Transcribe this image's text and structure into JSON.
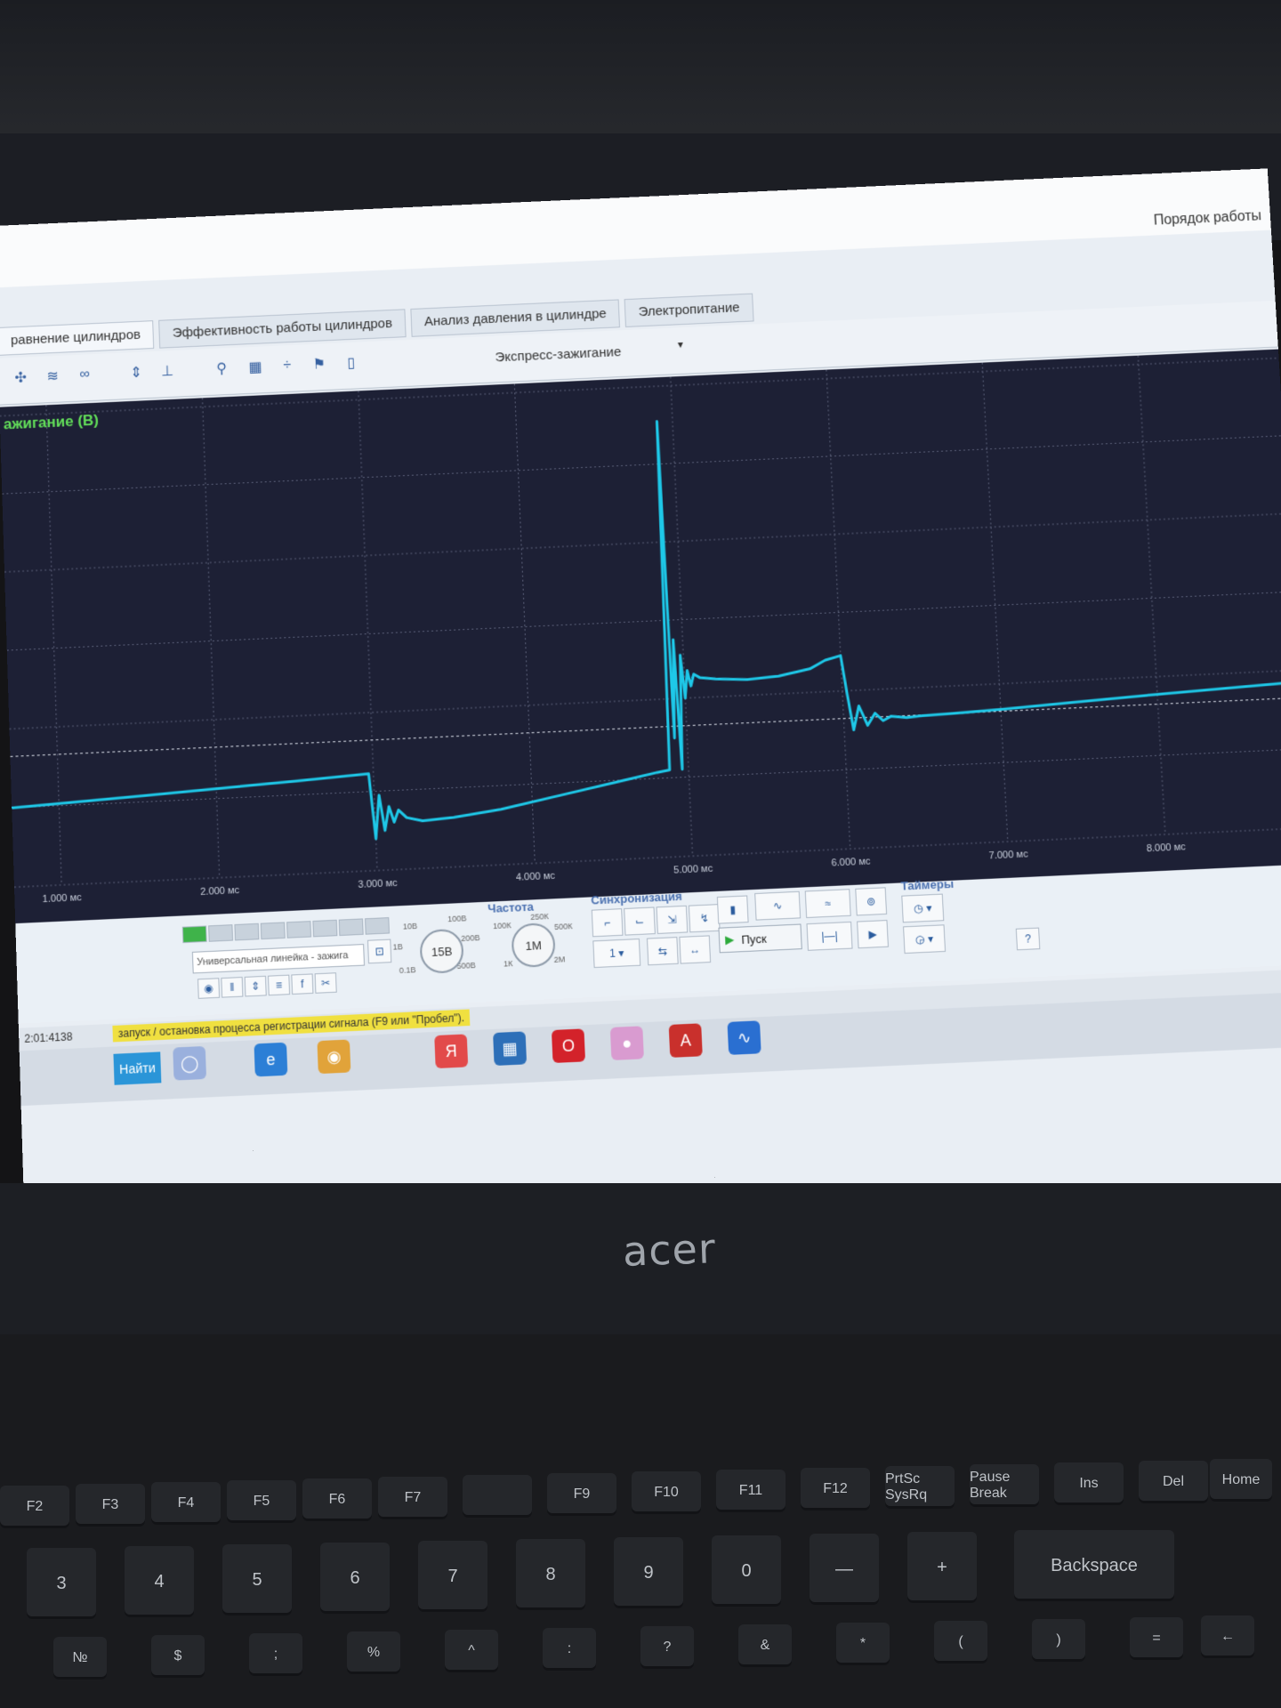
{
  "window": {
    "title": "Порядок работы"
  },
  "tabs": [
    {
      "label": "равнение цилиндров",
      "active": true
    },
    {
      "label": "Эффективность работы цилиндров",
      "active": false
    },
    {
      "label": "Анализ давления в цилиндре",
      "active": false
    },
    {
      "label": "Электропитание",
      "active": false
    }
  ],
  "toolbar": {
    "mode": "Экспресс-зажигание",
    "icons": [
      "cursor-icon",
      "overlay-icon",
      "parade-icon",
      "raster-icon",
      "trigger-level-icon",
      "zero-icon",
      "filter-icon",
      "table-icon",
      "split-icon",
      "marker-icon",
      "document-icon"
    ]
  },
  "plot": {
    "channel_label": "ажигание (В)",
    "x_ticks": [
      "1.000 мс",
      "2.000 мс",
      "3.000 мс",
      "4.000 мс",
      "5.000 мс",
      "6.000 мс",
      "7.000 мс",
      "8.000 мс"
    ],
    "trace_color": "#1ec8e8",
    "grid_color": "#5a5f78",
    "background": "#1d2035"
  },
  "controls": {
    "preset": "Универсальная линейка - зажига",
    "voltage_knob": "15В",
    "voltage_marks": [
      "10В",
      "100В",
      "1В",
      "200В",
      "0.1В",
      "500В"
    ],
    "frequency_title": "Частота",
    "frequency_knob": "1М",
    "frequency_marks": [
      "250К",
      "100К",
      "500К",
      "1К",
      "2М"
    ],
    "sync_title": "Синхронизация",
    "sync_channel": "1",
    "start_label": "Пуск",
    "timers_title": "Таймеры"
  },
  "status": {
    "time": "2:01:4138",
    "hint": "запуск / остановка процесса регистрации сигнала (F9 или \"Пробел\")."
  },
  "taskbar": {
    "find_label": "Найти",
    "apps": [
      {
        "name": "ie-icon",
        "glyph": "e",
        "color": "#2c7fd6"
      },
      {
        "name": "yandex-icon",
        "glyph": "Я",
        "color": "#e24a4a"
      },
      {
        "name": "calculator-icon",
        "glyph": "▦",
        "color": "#2d6fb8"
      },
      {
        "name": "opera-icon",
        "glyph": "O",
        "color": "#d3222a"
      },
      {
        "name": "pdf-icon",
        "glyph": "A",
        "color": "#c9302c"
      },
      {
        "name": "oscilloscope-app-icon",
        "glyph": "∿",
        "color": "#2a6fd1"
      }
    ]
  },
  "laptop": {
    "brand": "acer"
  },
  "keyboard": {
    "row_f": [
      "F2",
      "F3",
      "F4",
      "F5",
      "F6",
      "F7",
      "",
      "F9",
      "F10",
      "F11",
      "F12",
      "PrtSc SysRq",
      "Pause Break",
      "Ins",
      "Del",
      "Home"
    ],
    "row_num": [
      "3",
      "4",
      "5",
      "6",
      "7",
      "8",
      "9",
      "0",
      "—",
      "+",
      "Backspace"
    ],
    "row_sym": [
      "№",
      "$",
      ";",
      "%",
      "^",
      ":",
      "?",
      "&",
      "*",
      "(",
      ")",
      "=",
      "←"
    ]
  },
  "chart_data": {
    "type": "line",
    "xlabel": "",
    "ylabel": "",
    "title": "ажигание (В)",
    "x_unit": "мс",
    "xlim": [
      0.7,
      8.9
    ],
    "ylim": [
      -2,
      10
    ],
    "x_ticks": [
      1,
      2,
      3,
      4,
      5,
      6,
      7,
      8
    ],
    "series": [
      {
        "x": [
          0.7,
          1.5,
          2.5,
          2.97,
          3.0,
          3.03,
          3.06,
          3.09,
          3.12,
          3.15,
          3.2,
          3.3,
          3.5,
          3.8,
          4.2,
          4.6,
          4.8,
          4.88,
          4.9,
          4.92,
          4.94,
          4.96,
          4.98,
          5.0,
          5.02,
          5.04,
          5.06,
          5.1,
          5.2,
          5.4,
          5.6,
          5.8,
          5.9,
          6.0,
          6.03,
          6.06,
          6.1,
          6.15,
          6.2,
          6.25,
          6.3,
          6.4,
          6.5,
          6.7,
          7.0,
          7.5,
          8.0,
          8.9
        ],
        "y": [
          0.0,
          0.15,
          0.35,
          0.45,
          -1.2,
          -0.1,
          -1.0,
          -0.4,
          -0.8,
          -0.5,
          -0.7,
          -0.8,
          -0.75,
          -0.6,
          -0.3,
          0.0,
          0.15,
          0.2,
          9.1,
          1.0,
          3.5,
          0.2,
          3.1,
          2.0,
          2.7,
          2.3,
          2.6,
          2.5,
          2.45,
          2.4,
          2.45,
          2.6,
          2.8,
          2.9,
          1.9,
          1.0,
          1.6,
          1.1,
          1.4,
          1.2,
          1.3,
          1.25,
          1.28,
          1.3,
          1.35,
          1.45,
          1.55,
          1.7
        ]
      }
    ],
    "grid": true,
    "legend": "none"
  }
}
